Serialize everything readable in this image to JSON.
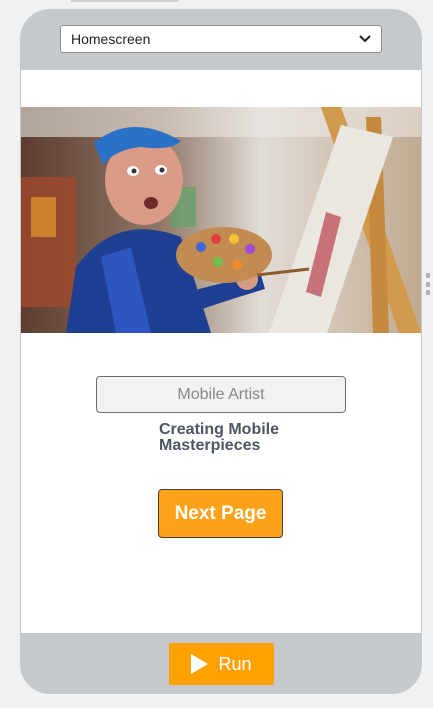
{
  "screen_selector": {
    "selected": "Homescreen"
  },
  "hero_image": {
    "description_icon": "artist-painting-image"
  },
  "name_field": {
    "placeholder": "Mobile Artist"
  },
  "subtitle": "Creating Mobile Masterpieces",
  "next_button": {
    "label": "Next Page"
  },
  "run_button": {
    "label": "Run",
    "icon": "play-icon"
  },
  "colors": {
    "device_frame": "#c6c9cc",
    "accent_orange": "#ffa200",
    "subtitle_text": "#4c5664"
  }
}
